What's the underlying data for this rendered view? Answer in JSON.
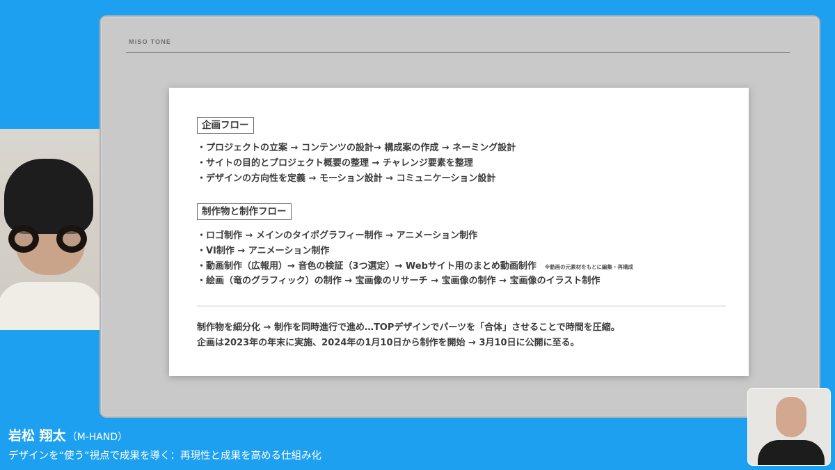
{
  "slide": {
    "brand": "MiSO TONE",
    "sections": [
      {
        "title": "企画フロー",
        "items": [
          "・プロジェクトの立案 → コンテンツの設計→ 構成案の作成 → ネーミング設計",
          "・サイトの目的とプロジェクト概要の整理 → チャレンジ要素を整理",
          "・デザインの方向性を定義 → モーション設計 → コミュニケーション設計"
        ]
      },
      {
        "title": "制作物と制作フロー",
        "items": [
          "・ロゴ制作 → メインのタイポグラフィー制作 → アニメーション制作",
          "・VI制作 → アニメーション制作",
          "・動画制作（広報用）→ 音色の検証（3つ選定）→ Webサイト用のまとめ動画制作",
          "・絵画（竜のグラフィック）の制作 → 宝画像のリサーチ → 宝画像の制作 → 宝画像のイラスト制作"
        ],
        "note": "※動画の元素材をもとに編集・再構成"
      }
    ],
    "summary": [
      "制作物を細分化 → 制作を同時進行で進め…TOPデザインでパーツを「合体」させることで時間を圧縮。",
      "企画は2023年の年末に実施、2024年の1月10日から制作を開始 → 3月10日に公開に至る。"
    ]
  },
  "speaker": {
    "name": "岩松 翔太",
    "org": "（M-HAND）",
    "talk_title": "デザインを“使う”視点で成果を導く：再現性と成果を高める仕組み化"
  },
  "colors": {
    "background": "#1ea0f0",
    "slide_frame": "#c9c9c9",
    "card": "#ffffff"
  }
}
